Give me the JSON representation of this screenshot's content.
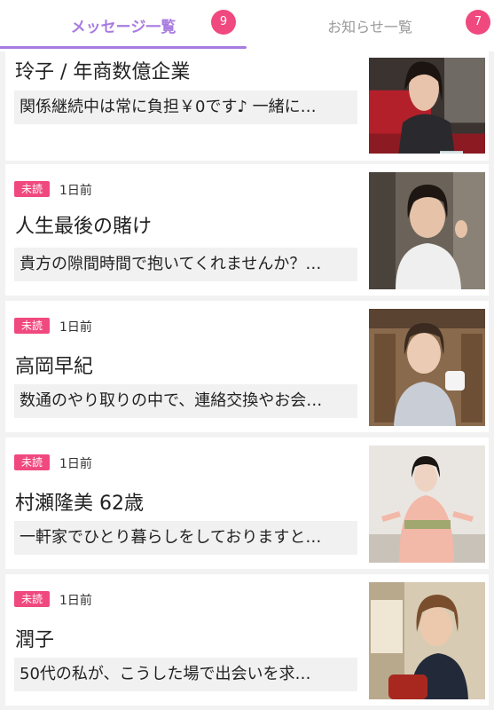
{
  "tabs": [
    {
      "label": "メッセージ一覧",
      "count": "9"
    },
    {
      "label": "お知らせ一覧",
      "count": "7"
    }
  ],
  "unread_label": "未読",
  "colors": {
    "accent": "#a77be0",
    "badge": "#f0497f",
    "preview_bg": "#f1f1f1"
  },
  "messages": [
    {
      "name": "玲子 / 年商数億企業",
      "preview": "関係継続中は常に負担￥0です♪ 一緒に…",
      "time": "",
      "unread": true
    },
    {
      "name": "人生最後の賭け",
      "preview": "貴方の隙間時間で抱いてくれませんか？…",
      "time": "1日前",
      "unread": true
    },
    {
      "name": "高岡早紀",
      "preview": "数通のやり取りの中で、連絡交換やお会…",
      "time": "1日前",
      "unread": true
    },
    {
      "name": "村瀬隆美 62歳",
      "preview": "一軒家でひとり暮らしをしておりますと…",
      "time": "1日前",
      "unread": true
    },
    {
      "name": "潤子",
      "preview": "50代の私が、こうした場で出会いを求…",
      "time": "1日前",
      "unread": true
    }
  ]
}
